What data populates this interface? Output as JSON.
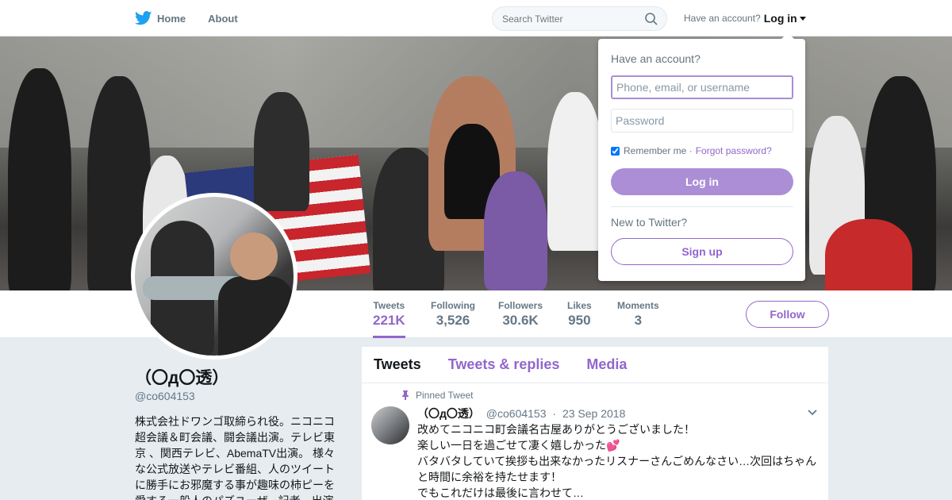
{
  "nav": {
    "home_label": "Home",
    "about_label": "About",
    "search_placeholder": "Search Twitter",
    "have_account": "Have an account?",
    "login_label": "Log in"
  },
  "profile_nav": {
    "stats": [
      {
        "label": "Tweets",
        "value": "221K"
      },
      {
        "label": "Following",
        "value": "3,526"
      },
      {
        "label": "Followers",
        "value": "30.6K"
      },
      {
        "label": "Likes",
        "value": "950"
      },
      {
        "label": "Moments",
        "value": "3"
      }
    ],
    "follow_label": "Follow"
  },
  "profile": {
    "name": "（〇д〇透）",
    "handle": "@co604153",
    "bio": "株式会社ドワンゴ取締られ役。ニコニコ超会議＆町会議、闘会議出演。テレビ東京 、関西テレビ、AbemaTV出演。 様々な公式放送やテレビ番組、人のツイートに勝手にお邪魔する事が趣味の柿ピーを愛する一般人のパズユーザ、記者、出演"
  },
  "timeline": {
    "tabs": [
      "Tweets",
      "Tweets & replies",
      "Media"
    ],
    "pinned_label": "Pinned Tweet",
    "tweet": {
      "name": "（〇д〇透）",
      "handle": "@co604153",
      "date": "23 Sep 2018",
      "line1": "改めてニコニコ町会議名古屋ありがとうございました！",
      "line2": "楽しい一日を過ごせて凄く嬉しかった",
      "line3": "バタバタしていて挨拶も出来なかったリスナーさんごめんなさい…次回はちゃんと時間に余裕を持たせます！",
      "line4": "でもこれだけは最後に言わせて…"
    }
  },
  "login_dropdown": {
    "title": "Have an account?",
    "username_placeholder": "Phone, email, or username",
    "password_placeholder": "Password",
    "remember_label": "Remember me",
    "forgot_label": "Forgot password?",
    "login_button": "Log in",
    "new_label": "New to Twitter?",
    "signup_button": "Sign up"
  },
  "colors": {
    "accent": "#9266cc",
    "twitter_blue": "#1da1f2"
  }
}
